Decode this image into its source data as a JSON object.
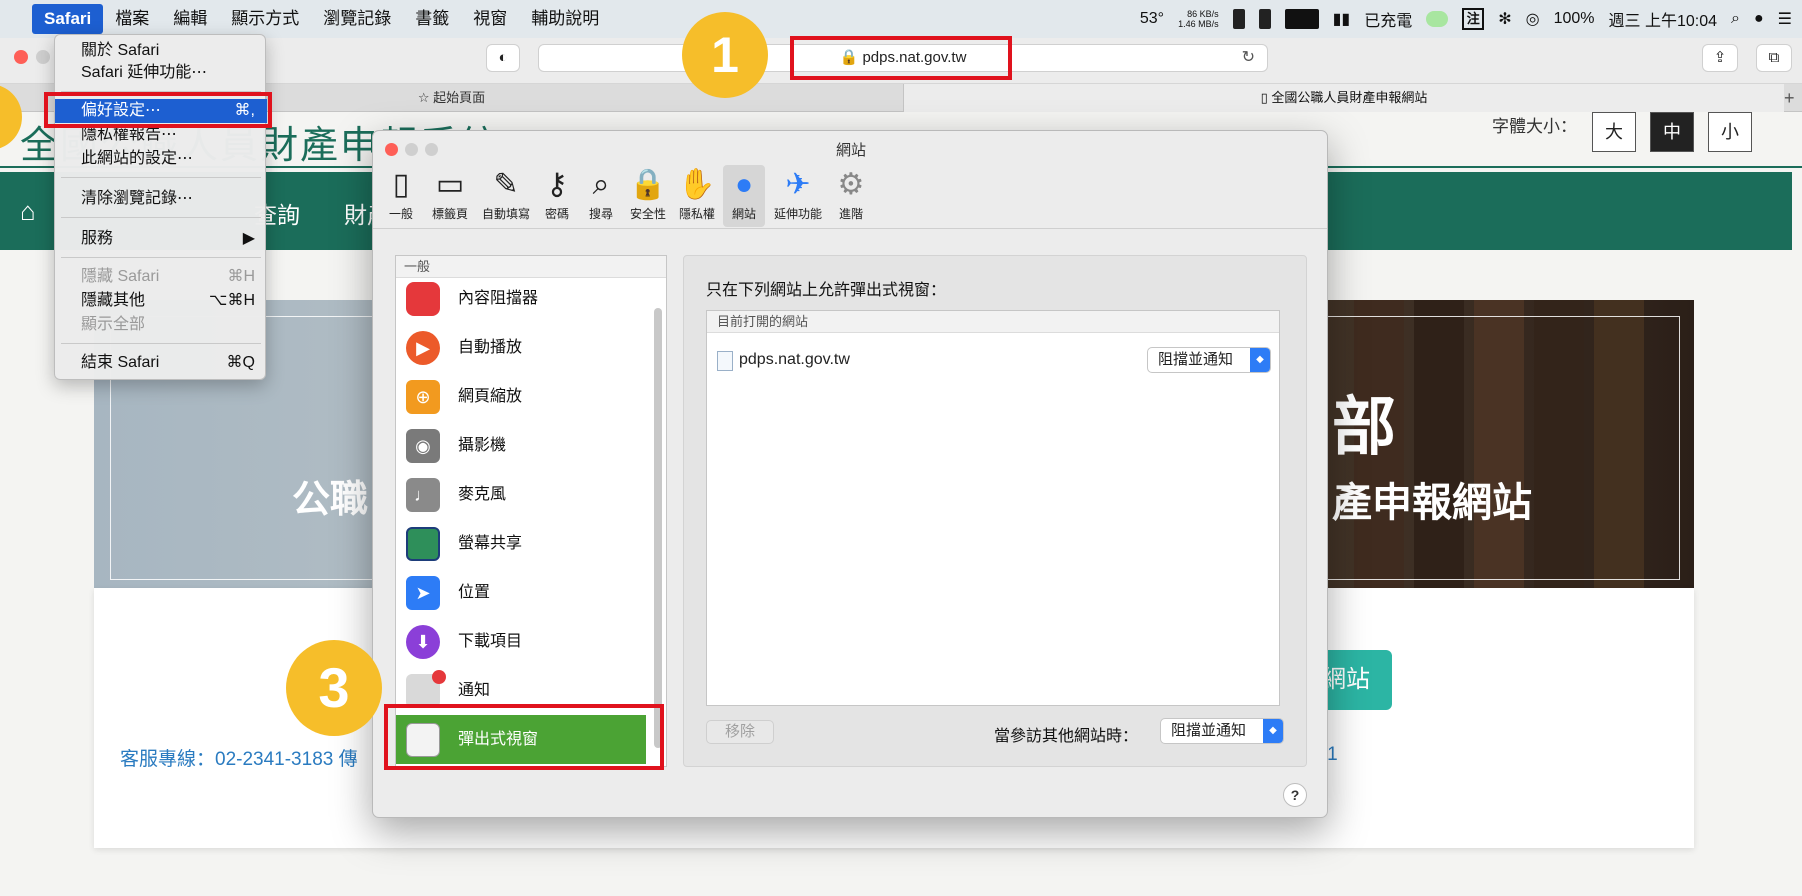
{
  "menubar": {
    "apple": "",
    "app": "Safari",
    "items": [
      "檔案",
      "編輯",
      "顯示方式",
      "瀏覽記錄",
      "書籤",
      "視窗",
      "輔助說明"
    ],
    "status": {
      "temp": "53°",
      "net_up": "86 KB/s",
      "net_down": "1.46 MB/s",
      "charging": "已充電",
      "input_method": "注",
      "battery": "100%",
      "clock": "週三 上午10:04"
    }
  },
  "toolbar": {
    "url": "pdps.nat.gov.tw",
    "reload": "↻"
  },
  "tabs": {
    "start": "☆ 起始頁面",
    "current": "全國公職人員財產申報網站",
    "add": "+"
  },
  "page": {
    "site_title": "全國公職人員財產申報系統",
    "font_size_label": "字體大小：",
    "font_sizes": [
      "大",
      "中",
      "小"
    ],
    "nav": [
      "查詢",
      "財產"
    ],
    "banner_left": "公職",
    "banner_right_big": "部",
    "banner_right_sub": "產申報網站",
    "site_button": "網站",
    "hotline": "客服專線：02-2341-3183 傳",
    "fax_fragment": "361"
  },
  "safari_menu": {
    "about": "關於 Safari",
    "extensions": "Safari 延伸功能⋯",
    "preferences": "偏好設定⋯",
    "preferences_shortcut": "⌘,",
    "privacy_report": "隱私權報告⋯",
    "site_settings": "此網站的設定⋯",
    "clear_history": "清除瀏覽記錄⋯",
    "services": "服務",
    "services_arrow": "▶",
    "hide": "隱藏 Safari",
    "hide_shortcut": "⌘H",
    "hide_others": "隱藏其他",
    "hide_others_shortcut": "⌥⌘H",
    "show_all": "顯示全部",
    "quit": "結束 Safari",
    "quit_shortcut": "⌘Q"
  },
  "prefs": {
    "title": "網站",
    "tabs": [
      "一般",
      "標籤頁",
      "自動填寫",
      "密碼",
      "搜尋",
      "安全性",
      "隱私權",
      "網站",
      "延伸功能",
      "進階"
    ],
    "sidebar_header": "一般",
    "sidebar_items": [
      "內容阻擋器",
      "自動播放",
      "網頁縮放",
      "攝影機",
      "麥克風",
      "螢幕共享",
      "位置",
      "下載項目",
      "通知",
      "彈出式視窗"
    ],
    "heading": "只在下列網站上允許彈出式視窗：",
    "table_header": "目前打開的網站",
    "row_domain": "pdps.nat.gov.tw",
    "row_select": "阻擋並通知",
    "remove": "移除",
    "other_sites_label": "當參訪其他網站時：",
    "other_sites_select": "阻擋並通知",
    "help": "?"
  },
  "annotations": {
    "step1": "1",
    "step3": "3"
  },
  "colors": {
    "accent": "#1d5fd1",
    "site_green": "#1b6d5a",
    "selected_green": "#4ba334",
    "annotation_red": "#e0121d",
    "annotation_yellow": "#f6be2a"
  }
}
